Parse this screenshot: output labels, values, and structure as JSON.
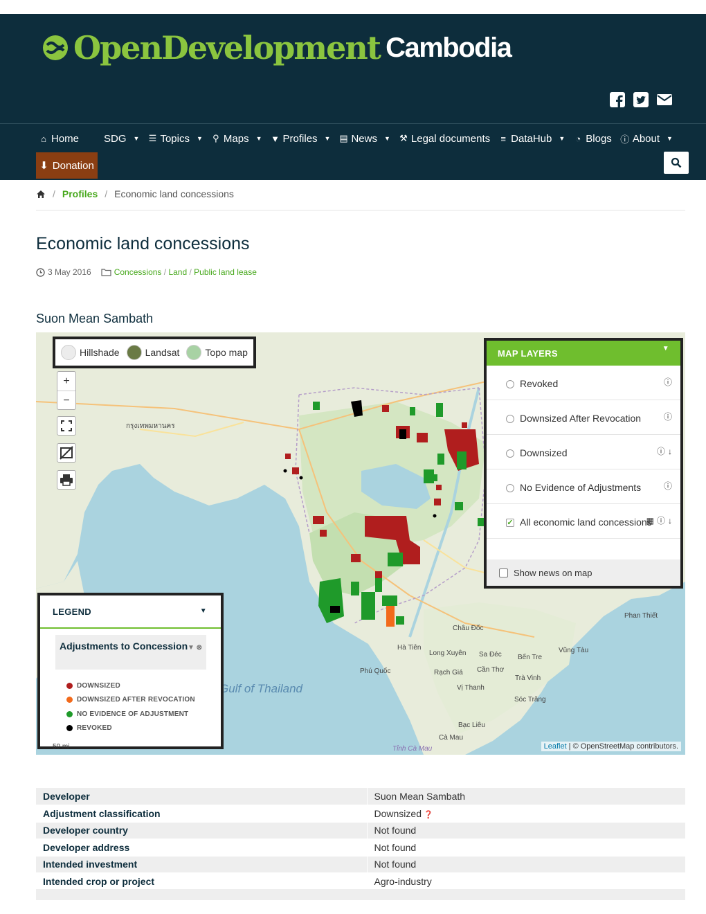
{
  "site": {
    "brand_open": "OpenDevelopment",
    "brand_country": "Cambodia",
    "social_icons": [
      "facebook-icon",
      "twitter-icon",
      "envelope-icon"
    ]
  },
  "nav": {
    "items": [
      {
        "label": "Home",
        "icon": "home-icon"
      },
      {
        "label": "SDG",
        "icon": "",
        "caret": true
      },
      {
        "label": "Topics",
        "icon": "list-icon",
        "caret": true
      },
      {
        "label": "Maps",
        "icon": "map-marker-icon",
        "caret": true
      },
      {
        "label": "Profiles",
        "icon": "filter-icon",
        "caret": true
      },
      {
        "label": "News",
        "icon": "newspaper-icon",
        "caret": true
      },
      {
        "label": "Legal documents",
        "icon": "gavel-icon"
      },
      {
        "label": "DataHub",
        "icon": "database-icon",
        "caret": true
      },
      {
        "label": "Blogs",
        "icon": "rss-icon"
      },
      {
        "label": "About",
        "icon": "info-icon",
        "caret": true
      }
    ],
    "donation_label": "Donation",
    "search_icon": "search-icon"
  },
  "breadcrumb": {
    "home_icon": "home-icon",
    "profiles": "Profiles",
    "current": "Economic land concessions"
  },
  "page": {
    "title": "Economic land concessions",
    "date": "3 May 2016",
    "tags": [
      "Concessions",
      "Land",
      "Public land lease"
    ],
    "tag_sep": "/"
  },
  "profile": {
    "developer_heading": "Suon Mean Sambath"
  },
  "map": {
    "basemaps": [
      "Hillshade",
      "Landsat",
      "Topo map"
    ],
    "zoom_in": "+",
    "zoom_out": "−",
    "layers_title": "MAP LAYERS",
    "layers": [
      {
        "label": "Revoked",
        "checked": false
      },
      {
        "label": "Downsized After Revocation",
        "checked": false
      },
      {
        "label": "Downsized",
        "checked": false
      },
      {
        "label": "No Evidence of Adjustments",
        "checked": false
      },
      {
        "label": "All economic land concessions",
        "checked": true
      }
    ],
    "show_news": "Show news on map",
    "legend_title": "LEGEND",
    "legend_group": "Adjustments to Concession",
    "legend_items": [
      {
        "label": "DOWNSIZED",
        "color": "#b01e1e"
      },
      {
        "label": "DOWNSIZED AFTER REVOCATION",
        "color": "#f26a1b"
      },
      {
        "label": "NO EVIDENCE OF ADJUSTMENT",
        "color": "#1f9a2a"
      },
      {
        "label": "REVOKED",
        "color": "#000000"
      }
    ],
    "scale": "50 mi",
    "attribution_leaflet": "Leaflet",
    "attribution_rest": " | © OpenStreetMap contributors.",
    "place_labels": [
      "กรุงเทพมหานคร",
      "Gulf of Thailand",
      "Châu Đốc",
      "Hà Tiên",
      "Long Xuyên",
      "Sa Đéc",
      "Bến Tre",
      "Vũng Tàu",
      "Phú Quốc",
      "Rạch Giá",
      "Cần Thơ",
      "Trà Vinh",
      "Vị Thanh",
      "Sóc Trăng",
      "Bạc Liêu",
      "Cà Mau",
      "Phan Thiết",
      "Tỉnh Cà Mau"
    ]
  },
  "details": [
    {
      "key": "Developer",
      "value": "Suon Mean Sambath"
    },
    {
      "key": "Adjustment classification",
      "value": "Downsized"
    },
    {
      "key": "Developer country",
      "value": "Not found"
    },
    {
      "key": "Developer address",
      "value": "Not found"
    },
    {
      "key": "Intended investment",
      "value": "Not found"
    },
    {
      "key": "Intended crop or project",
      "value": "Agro-industry"
    }
  ],
  "colors": {
    "header_bg": "#0d2d3c",
    "brand_green": "#8bc53f",
    "link_green": "#47a81c",
    "donation_bg": "#8a3e12",
    "panel_green": "#6fbe2e"
  }
}
